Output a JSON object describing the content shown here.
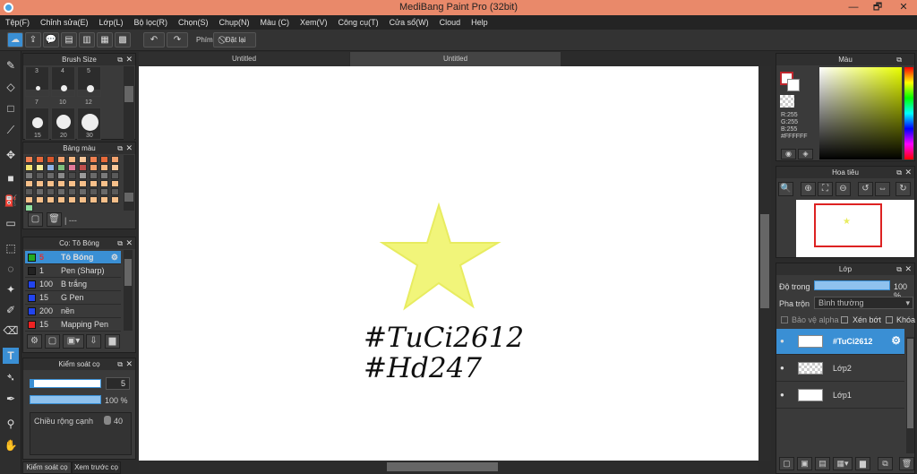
{
  "window": {
    "title": "MediBang Paint Pro (32bit)",
    "minimize": "—",
    "restore": "🗗",
    "close": "✕"
  },
  "menu": [
    "Tệp(F)",
    "Chỉnh sửa(E)",
    "Lớp(L)",
    "Bộ lọc(R)",
    "Chọn(S)",
    "Chụp(N)",
    "Màu (C)",
    "Xem(V)",
    "Công cụ(T)",
    "Cửa sổ(W)",
    "Cloud",
    "Help"
  ],
  "toolbar": {
    "shortcut_label": "Phím",
    "reset_label": "Đặt lại"
  },
  "brush_size": {
    "title": "Brush Size",
    "sizes": [
      "3",
      "4",
      "5",
      "7",
      "10",
      "12",
      "15",
      "20",
      "30"
    ]
  },
  "palette": {
    "title": "Bảng màu",
    "footer": "| ---"
  },
  "brush_panel": {
    "title": "Cọ: Tô Bóng",
    "items": [
      {
        "size": "5",
        "name": "Tô Bóng",
        "color": "#22aa22",
        "selected": true
      },
      {
        "size": "1",
        "name": "Pen (Sharp)",
        "color": "#222222"
      },
      {
        "size": "100",
        "name": "B trắng",
        "color": "#2244ee"
      },
      {
        "size": "15",
        "name": "G Pen",
        "color": "#2244ee"
      },
      {
        "size": "200",
        "name": "nền",
        "color": "#2244ee"
      },
      {
        "size": "15",
        "name": "Mapping Pen",
        "color": "#ee2222"
      }
    ]
  },
  "brush_control": {
    "title": "Kiểm soát cọ",
    "size_value": "5",
    "opacity_value": "100 %",
    "width_label": "Chiều rộng cạnh",
    "width_value": "40"
  },
  "bottom_tabs": [
    "Kiểm soát cọ",
    "Xem trước cọ"
  ],
  "tabs": [
    "Untitled",
    "Untitled"
  ],
  "canvas_text": {
    "line1": "#TuCi2612",
    "line2": "#Hd247"
  },
  "colors": {
    "star": "#f1f57a",
    "accent": "#3a8fd4"
  },
  "color_panel": {
    "title": "Màu",
    "r": "R:255",
    "g": "G:255",
    "b": "B:255",
    "hex": "#FFFFFF"
  },
  "navigator": {
    "title": "Hoa tiêu"
  },
  "layer_panel": {
    "title": "Lớp",
    "opacity_label": "Độ trong",
    "opacity_value": "100 %",
    "blend_label": "Pha trộn",
    "blend_value": "Bình thường",
    "protect_alpha": "Bảo vệ alpha",
    "clipping": "Xén bớt",
    "lock": "Khóa",
    "layers": [
      {
        "name": "#TuCi2612",
        "selected": true
      },
      {
        "name": "Lớp2"
      },
      {
        "name": "Lớp1"
      }
    ]
  }
}
